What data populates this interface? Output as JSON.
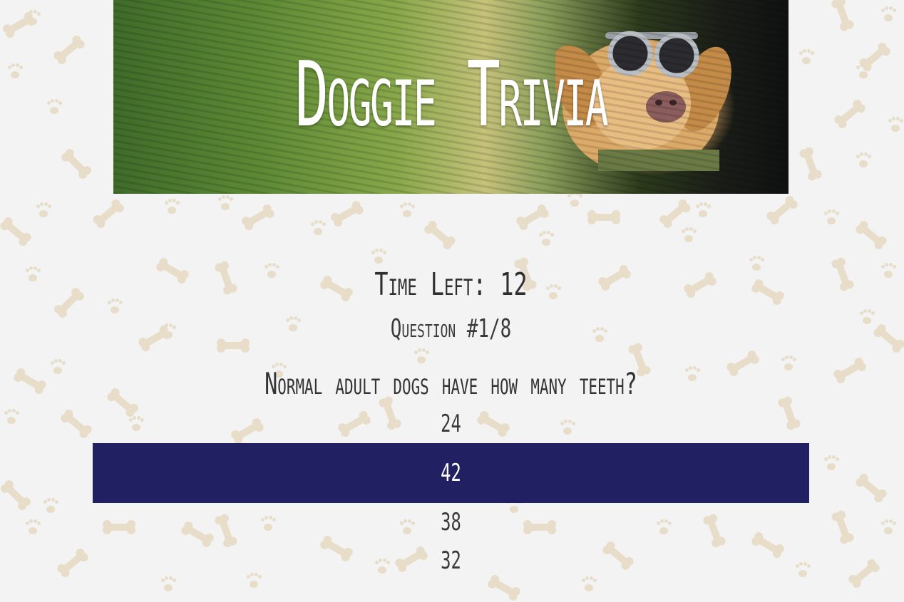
{
  "header": {
    "title": "Doggie Trivia",
    "banner_image": "dog-in-car-with-goggles"
  },
  "quiz": {
    "time_left_label": "Time Left: 12",
    "question_number_label": "Question #1/8",
    "question_text": "Normal adult dogs have how many teeth?",
    "answers": [
      {
        "label": "24",
        "selected": false
      },
      {
        "label": "42",
        "selected": true
      },
      {
        "label": "38",
        "selected": false
      },
      {
        "label": "32",
        "selected": false
      }
    ]
  },
  "colors": {
    "background": "#f3f3f3",
    "pattern": "#e7ddc9",
    "selected_answer_bg": "#202062",
    "text": "#333333"
  }
}
